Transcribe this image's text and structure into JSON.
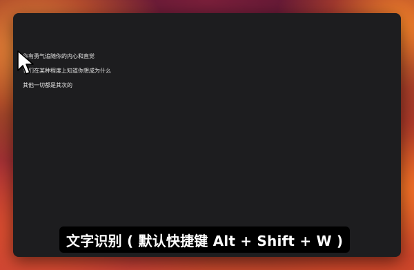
{
  "window": {
    "ocr_lines": [
      "你有勇气追随你的内心和直觉",
      "它们在某种程度上知道你想成为什么",
      "其他一切都是其次的"
    ]
  },
  "caption": {
    "text": "文字识别 ( 默认快捷键 Alt + Shift + W )"
  },
  "icons": {
    "cursor": "mouse-pointer-icon"
  },
  "colors": {
    "window_bg": "#1d1d1f",
    "caption_bg": "#000000",
    "text": "#e6e6e6"
  }
}
